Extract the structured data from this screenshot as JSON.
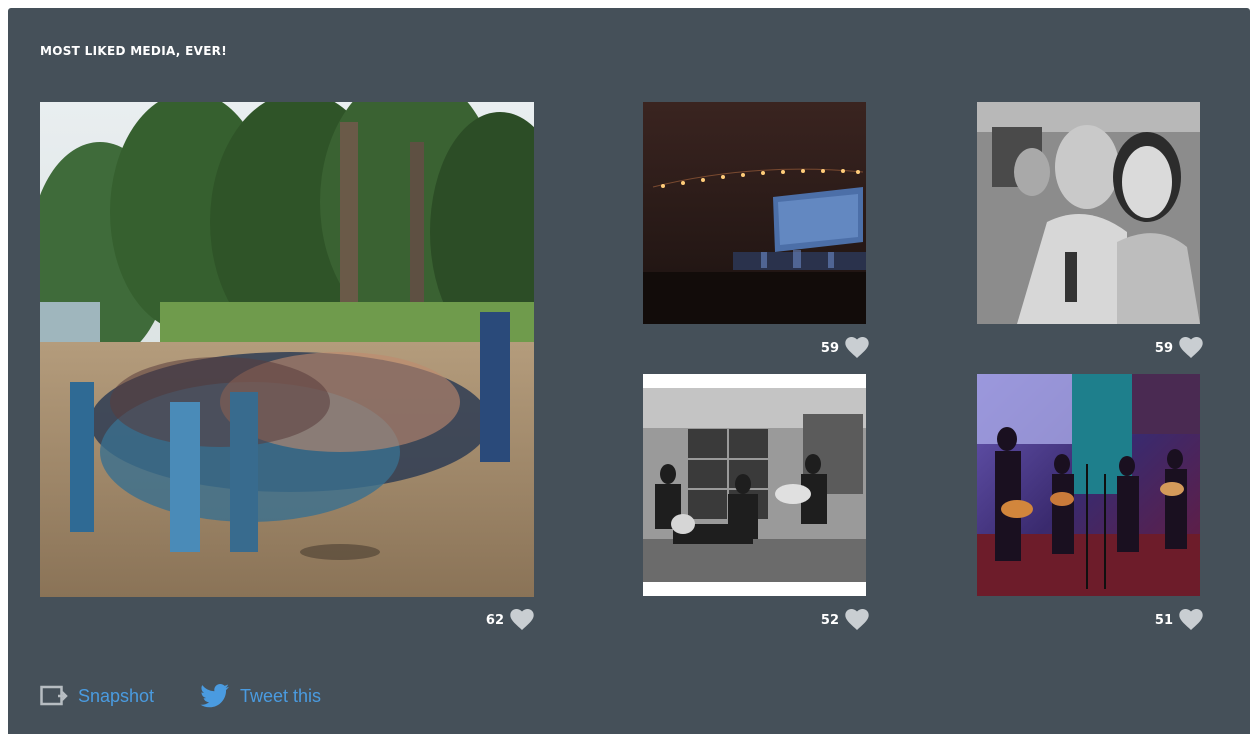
{
  "panel": {
    "title": "MOST LIKED MEDIA, EVER!"
  },
  "media": [
    {
      "likes": "62",
      "subject": "group of campers in a circle outdoors by a lake",
      "icon": "heart-icon"
    },
    {
      "likes": "59",
      "subject": "worship concert in a dark room with string lights",
      "icon": "heart-icon"
    },
    {
      "likes": "59",
      "subject": "black and white selfie of a couple",
      "icon": "heart-icon"
    },
    {
      "likes": "52",
      "subject": "black and white photo of musicians playing guitars in a living room",
      "icon": "heart-icon"
    },
    {
      "likes": "51",
      "subject": "band performing on stage with colorful lights",
      "icon": "heart-icon"
    }
  ],
  "footer": {
    "snapshot_label": "Snapshot",
    "snapshot_icon": "snapshot-icon",
    "tweet_label": "Tweet this",
    "tweet_icon": "twitter-bird-icon"
  },
  "colors": {
    "panel_bg": "#455059",
    "heart": "#c9ced2",
    "link": "#4a9be0"
  }
}
